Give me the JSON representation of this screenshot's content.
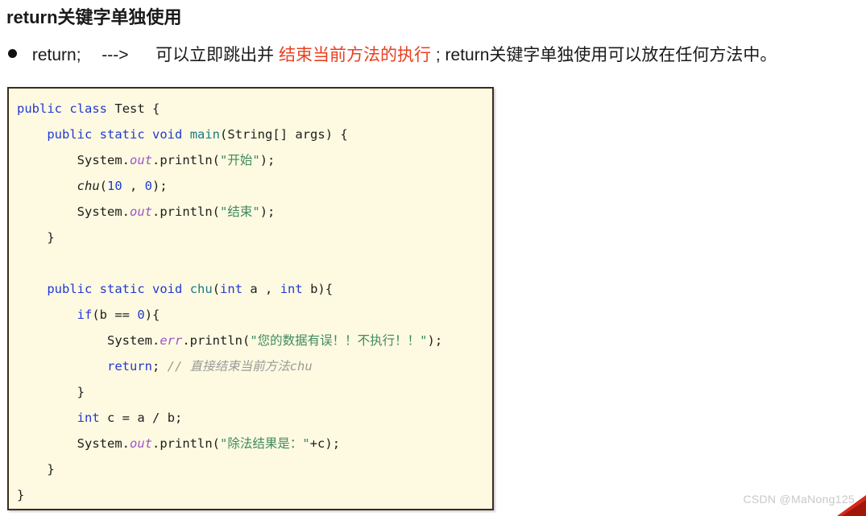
{
  "heading": "return关键字单独使用",
  "bullet": {
    "marker": "bullet-dot",
    "keyword": "return;",
    "arrow": "--->",
    "text_before_highlight": "可以立即跳出并",
    "highlight": "结束当前方法的执行",
    "highlight_color": "#e8401f",
    "text_after_highlight": ";  return关键字单独使用可以放在任何方法中。"
  },
  "code_block": {
    "language": "java",
    "background_color": "#fdfae1",
    "border_color": "#3b2b20",
    "token_colors": {
      "keyword": "#2339d4",
      "method": "#1a7a86",
      "field": "#9b55c9",
      "string": "#3f8a5e",
      "number": "#2339d4",
      "comment": "#9a9a9a",
      "plain": "#1d1d1d"
    },
    "lines": [
      "public class Test {",
      "    public static void main(String[] args) {",
      "        System.out.println(\"开始\");",
      "        chu(10 , 0);",
      "        System.out.println(\"结束\");",
      "    }",
      "",
      "    public static void chu(int a , int b){",
      "        if(b == 0){",
      "            System.err.println(\"您的数据有误！！不执行！！\");",
      "            return; // 直接结束当前方法chu",
      "        }",
      "        int c = a / b;",
      "        System.out.println(\"除法结果是：\"+c);",
      "    }",
      "}"
    ]
  },
  "watermark": {
    "text": "CSDN @MaNong125",
    "color": "#c9c9c9",
    "corner_color": "#d6291a",
    "corner_shadow_color": "#a01608"
  }
}
